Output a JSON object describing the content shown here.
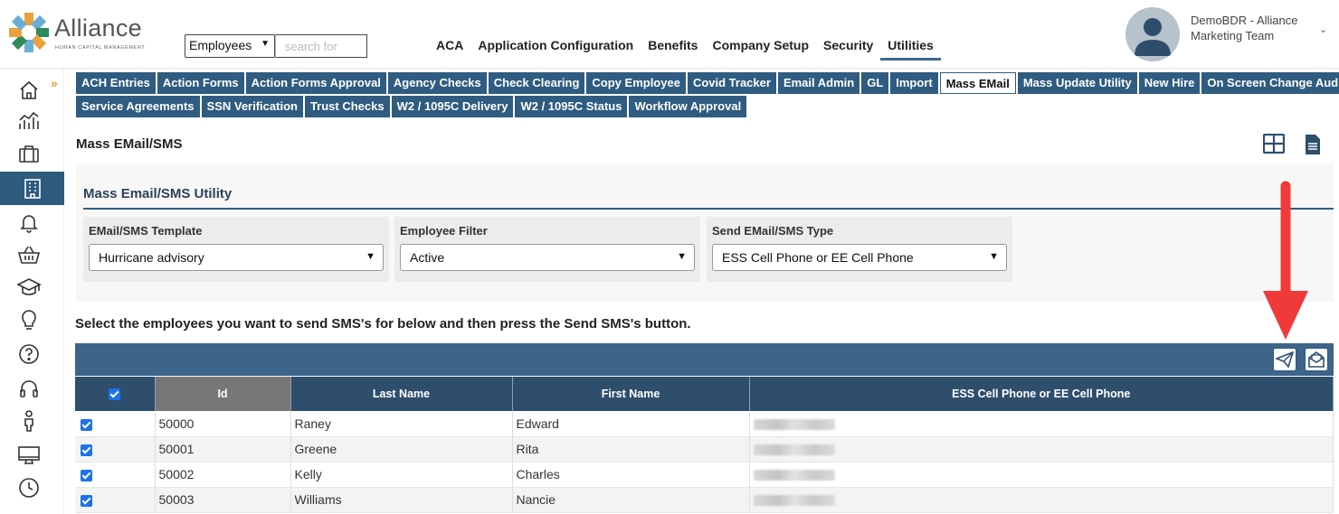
{
  "brand": {
    "name": "Alliance",
    "tagline": "HUMAN CAPITAL MANAGEMENT"
  },
  "search": {
    "scope": "Employees",
    "placeholder": "search for"
  },
  "topnav": [
    "ACA",
    "Application Configuration",
    "Benefits",
    "Company Setup",
    "Security",
    "Utilities"
  ],
  "topnav_active": "Utilities",
  "user": {
    "line1": "DemoBDR - Alliance",
    "line2": "Marketing Team"
  },
  "sidebar": [
    "home-icon",
    "chart-icon",
    "briefcase-icon",
    "building-icon",
    "bell-icon",
    "basket-icon",
    "graduation-cap-icon",
    "lightbulb-icon",
    "help-icon",
    "headset-icon",
    "person-icon",
    "monitor-icon",
    "clock-icon"
  ],
  "tabs_row1": [
    "ACH Entries",
    "Action Forms",
    "Action Forms Approval",
    "Agency Checks",
    "Check Clearing",
    "Copy Employee",
    "Covid Tracker",
    "Email Admin",
    "GL",
    "Import",
    "Mass EMail",
    "Mass Update Utility",
    "New Hire",
    "On Screen Change Audit"
  ],
  "tabs_row2": [
    "Service Agreements",
    "SSN Verification",
    "Trust Checks",
    "W2 / 1095C Delivery",
    "W2 / 1095C Status",
    "Workflow Approval"
  ],
  "active_tab": "Mass EMail",
  "page_title": "Mass EMail/SMS",
  "panel": {
    "title": "Mass Email/SMS Utility",
    "template": {
      "label": "EMail/SMS Template",
      "value": "Hurricane advisory"
    },
    "filter": {
      "label": "Employee Filter",
      "value": "Active"
    },
    "type": {
      "label": "Send EMail/SMS Type",
      "value": "ESS Cell Phone or EE Cell Phone"
    }
  },
  "instruction": "Select the employees you want to send SMS's for below and then press the Send SMS's button.",
  "grid": {
    "columns": [
      "Id",
      "Last Name",
      "First Name",
      "ESS Cell Phone or EE Cell Phone"
    ],
    "rows": [
      {
        "id": "50000",
        "last": "Raney",
        "first": "Edward"
      },
      {
        "id": "50001",
        "last": "Greene",
        "first": "Rita"
      },
      {
        "id": "50002",
        "last": "Kelly",
        "first": "Charles"
      },
      {
        "id": "50003",
        "last": "Williams",
        "first": "Nancie"
      }
    ]
  },
  "colors": {
    "primary": "#2f5c80",
    "toolbar": "#3d6489",
    "accent": "#e9a13b",
    "annotation": "#f03a3a"
  }
}
